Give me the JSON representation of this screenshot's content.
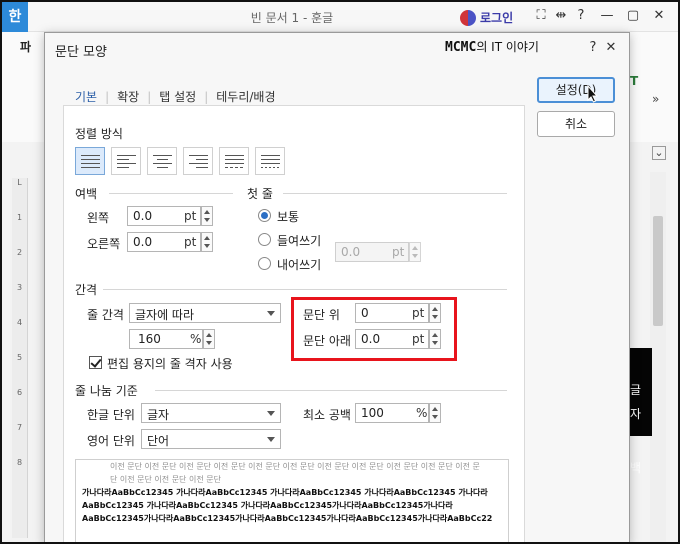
{
  "window": {
    "app_icon": "한",
    "title": "빈 문서 1 - 훈글",
    "login_label": "로그인",
    "icons": [
      "fullscreen-icon",
      "expand-icon",
      "help-icon",
      "minimize-icon",
      "restore-icon",
      "close-icon"
    ],
    "icon_glyphs": {
      "fullscreen": "⛶",
      "expand": "⇹",
      "help": "?",
      "minimize": "—",
      "restore": "▢",
      "close": "✕"
    }
  },
  "ribbon": {
    "file_label": "파",
    "right_icon_glyph": "T",
    "chevron": "»",
    "chevron2": "⌄"
  },
  "ruler": {
    "marks": [
      "L",
      "1",
      "2",
      "3",
      "4",
      "5",
      "6",
      "7",
      "8"
    ]
  },
  "background_text": {
    "line1": "글자",
    "line2": "백"
  },
  "dialog": {
    "title": "문단 모양",
    "watermark_brand": "MCMC",
    "watermark_suffix": "의 IT 이야기",
    "controls": {
      "help": "?",
      "close": "✕"
    },
    "tabs": [
      {
        "label": "기본",
        "active": true
      },
      {
        "label": "확장",
        "active": false
      },
      {
        "label": "탭 설정",
        "active": false
      },
      {
        "label": "테두리/배경",
        "active": false
      }
    ],
    "buttons": {
      "ok": "설정(D)",
      "cancel": "취소"
    },
    "alignment": {
      "title": "정렬 방식",
      "options": [
        "justify",
        "left",
        "center",
        "right",
        "distribute",
        "divide"
      ],
      "selected": "justify"
    },
    "margin": {
      "title": "여백",
      "left_label": "왼쪽",
      "left_value": "0.0",
      "right_label": "오른쪽",
      "right_value": "0.0",
      "unit": "pt"
    },
    "first_line": {
      "title": "첫 줄",
      "options": [
        "보통",
        "들여쓰기",
        "내어쓰기"
      ],
      "selected": "보통",
      "value": "0.0",
      "unit": "pt"
    },
    "spacing": {
      "title": "간격",
      "line_spacing_label": "줄 간격",
      "line_spacing_type": "글자에 따라",
      "line_spacing_value": "160",
      "line_spacing_unit": "%",
      "before_label": "문단 위",
      "before_value": "0",
      "after_label": "문단 아래",
      "after_value": "0.0",
      "unit": "pt",
      "grid_checkbox_label": "편집 용지의 줄 격자 사용",
      "grid_checked": true
    },
    "line_break": {
      "title": "줄 나눔 기준",
      "korean_label": "한글 단위",
      "korean_value": "글자",
      "english_label": "영어 단위",
      "english_value": "단어",
      "min_space_label": "최소 공백",
      "min_space_value": "100",
      "min_space_unit": "%"
    },
    "preview": {
      "prev_text": "이전 문단 이전 문단 이전 문단 이전 문단 이전 문단 이전 문단 이전 문단 이전 문단 이전 문단 이전 문단 이전 문단 이전 문단 이전 문단 이전 문단",
      "current_text": "가나다라AaBbCc12345   가나다라AaBbCc12345   가나다라AaBbCc12345   가나다라AaBbCc12345   가나다라AaBbCc12345   가나다라AaBbCc12345   가나다라AaBbCc12345가나다라AaBbCc12345가나다라AaBbCc12345가나다라AaBbCc12345가나다라AaBbCc12345가나다라AaBbCc12345가나다라AaBbCc22"
    }
  },
  "colors": {
    "highlight_border": "#e8141c",
    "accent": "#2c5fa8",
    "app_logo_bg": "#2d8ad9"
  }
}
